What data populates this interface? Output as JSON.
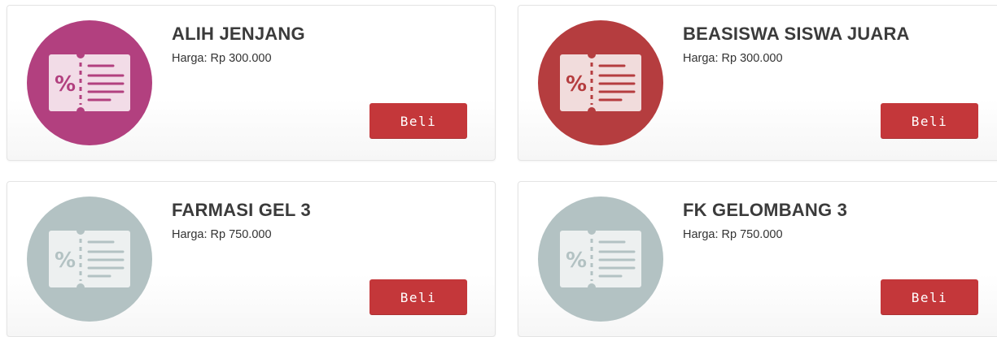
{
  "products": [
    {
      "title": "ALIH JENJANG",
      "price": "Harga: Rp 300.000",
      "button": "Beli",
      "icon": "voucher-icon",
      "circle_color": "#b2407f",
      "ticket_color": "#f2dce7",
      "ticket_ink": "#b2407f"
    },
    {
      "title": "BEASISWA SISWA JUARA",
      "price": "Harga: Rp 300.000",
      "button": "Beli",
      "icon": "voucher-icon",
      "circle_color": "#b53d3f",
      "ticket_color": "#f1dcdc",
      "ticket_ink": "#b53d3f"
    },
    {
      "title": "FARMASI GEL 3",
      "price": "Harga: Rp 750.000",
      "button": "Beli",
      "icon": "voucher-icon",
      "circle_color": "#b3c2c3",
      "ticket_color": "#edf0f0",
      "ticket_ink": "#b3c2c3"
    },
    {
      "title": "FK GELOMBANG 3",
      "price": "Harga: Rp 750.000",
      "button": "Beli",
      "icon": "voucher-icon",
      "circle_color": "#b3c2c3",
      "ticket_color": "#edf0f0",
      "ticket_ink": "#b3c2c3"
    }
  ]
}
